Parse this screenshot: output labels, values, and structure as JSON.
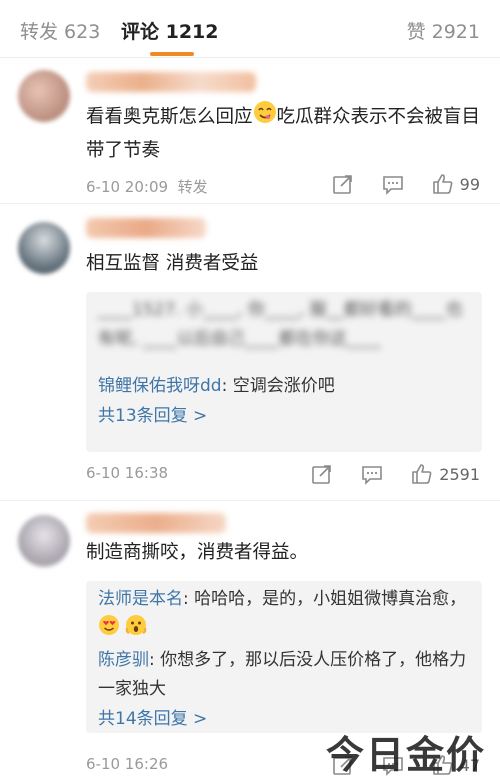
{
  "tabs": {
    "reposts": "转发 623",
    "comments": "评论 1212",
    "likes": "赞 2921"
  },
  "comments": [
    {
      "text_before": "看看奥克斯怎么回应",
      "text_after": "吃瓜群众表示不会被盲目带了节奏",
      "time": "6-10 20:09",
      "repost_label": "转发",
      "like_count": "99"
    },
    {
      "text": "相互监督 消费者受益",
      "blurred_reply": "____1527. 小____, 你____, 服__都好看的____也有呢, ____以后自己____都在你这____",
      "reply_user": "锦鲤保佑我呀dd",
      "reply_text": ": 空调会涨价吧",
      "more_replies": "共13条回复 >",
      "time": "6-10 16:38",
      "like_count": "2591"
    },
    {
      "text": "制造商撕咬，消费者得益。",
      "reply1_user": "法师是本名",
      "reply1_text": ": 哈哈哈，是的，小姐姐微博真治愈，",
      "reply2_user": "陈彦驯",
      "reply2_text": ": 你想多了，那以后没人压价格了，他格力一家独大",
      "more_replies": "共14条回复 >",
      "time": "6-10 16:26",
      "like_count": "47"
    }
  ],
  "watermark": "今日金价",
  "icons": {
    "share": "share-icon",
    "comment": "comment-icon",
    "like": "like-icon",
    "emoji_yum": "yum-emoji-icon",
    "emoji_heart_eyes": "heart-eyes-emoji-icon",
    "emoji_scream": "scream-emoji-icon"
  },
  "colors": {
    "accent": "#f08a24",
    "link": "#3f76a8",
    "muted": "#9a9a9a"
  }
}
